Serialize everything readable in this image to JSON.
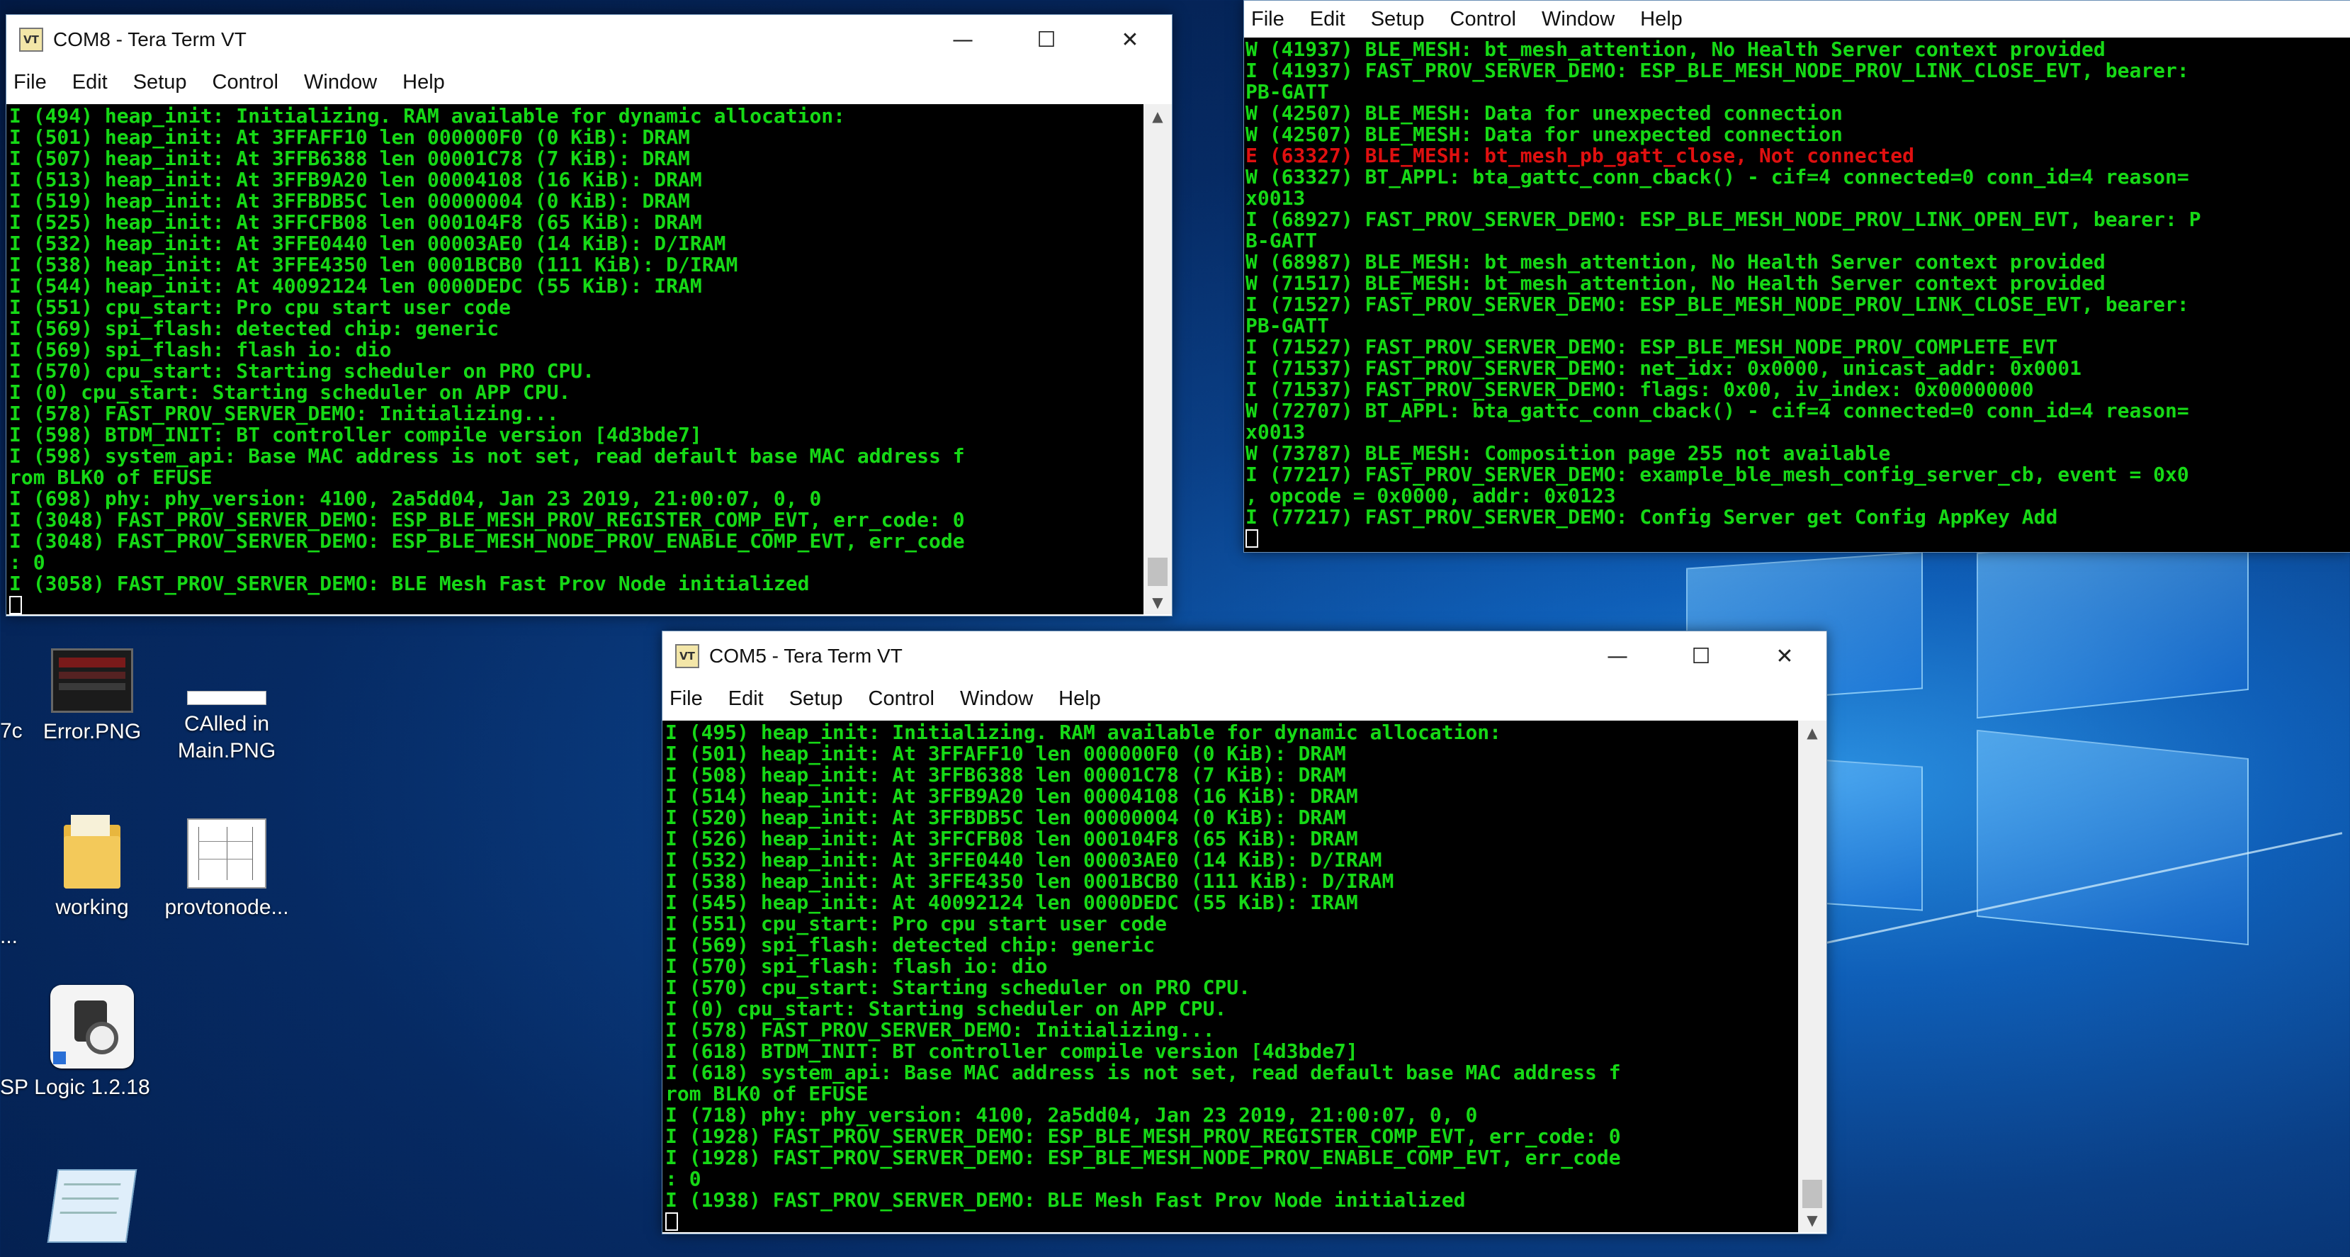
{
  "menu": [
    "File",
    "Edit",
    "Setup",
    "Control",
    "Window",
    "Help"
  ],
  "window_controls": {
    "minimize": "—",
    "maximize": "☐",
    "close": "✕"
  },
  "app_icon_text": "VT",
  "com8": {
    "title": "COM8 - Tera Term VT",
    "lines": [
      "I (494) heap_init: Initializing. RAM available for dynamic allocation:",
      "I (501) heap_init: At 3FFAFF10 len 000000F0 (0 KiB): DRAM",
      "I (507) heap_init: At 3FFB6388 len 00001C78 (7 KiB): DRAM",
      "I (513) heap_init: At 3FFB9A20 len 00004108 (16 KiB): DRAM",
      "I (519) heap_init: At 3FFBDB5C len 00000004 (0 KiB): DRAM",
      "I (525) heap_init: At 3FFCFB08 len 000104F8 (65 KiB): DRAM",
      "I (532) heap_init: At 3FFE0440 len 00003AE0 (14 KiB): D/IRAM",
      "I (538) heap_init: At 3FFE4350 len 0001BCB0 (111 KiB): D/IRAM",
      "I (544) heap_init: At 40092124 len 0000DEDC (55 KiB): IRAM",
      "I (551) cpu_start: Pro cpu start user code",
      "I (569) spi_flash: detected chip: generic",
      "I (569) spi_flash: flash io: dio",
      "I (570) cpu_start: Starting scheduler on PRO CPU.",
      "I (0) cpu_start: Starting scheduler on APP CPU.",
      "I (578) FAST_PROV_SERVER_DEMO: Initializing...",
      "I (598) BTDM_INIT: BT controller compile version [4d3bde7]",
      "I (598) system_api: Base MAC address is not set, read default base MAC address f",
      "rom BLK0 of EFUSE",
      "I (698) phy: phy_version: 4100, 2a5dd04, Jan 23 2019, 21:00:07, 0, 0",
      "I (3048) FAST_PROV_SERVER_DEMO: ESP_BLE_MESH_PROV_REGISTER_COMP_EVT, err_code: 0",
      "I (3048) FAST_PROV_SERVER_DEMO: ESP_BLE_MESH_NODE_PROV_ENABLE_COMP_EVT, err_code",
      ": 0",
      "I (3058) FAST_PROV_SERVER_DEMO: BLE Mesh Fast Prov Node initialized"
    ]
  },
  "right_term": {
    "lines": [
      {
        "t": "W (41937) BLE_MESH: bt_mesh_attention, No Health Server context provided",
        "c": "g"
      },
      {
        "t": "I (41937) FAST_PROV_SERVER_DEMO: ESP_BLE_MESH_NODE_PROV_LINK_CLOSE_EVT, bearer:",
        "c": "g"
      },
      {
        "t": "PB-GATT",
        "c": "g"
      },
      {
        "t": "W (42507) BLE_MESH: Data for unexpected connection",
        "c": "g"
      },
      {
        "t": "W (42507) BLE_MESH: Data for unexpected connection",
        "c": "g"
      },
      {
        "t": "E (63327) BLE_MESH: bt_mesh_pb_gatt_close, Not connected",
        "c": "r"
      },
      {
        "t": "W (63327) BT_APPL: bta_gattc_conn_cback() - cif=4 connected=0 conn_id=4 reason=",
        "c": "g"
      },
      {
        "t": "x0013",
        "c": "g"
      },
      {
        "t": "I (68927) FAST_PROV_SERVER_DEMO: ESP_BLE_MESH_NODE_PROV_LINK_OPEN_EVT, bearer: P",
        "c": "g"
      },
      {
        "t": "B-GATT",
        "c": "g"
      },
      {
        "t": "W (68987) BLE_MESH: bt_mesh_attention, No Health Server context provided",
        "c": "g"
      },
      {
        "t": "W (71517) BLE_MESH: bt_mesh_attention, No Health Server context provided",
        "c": "g"
      },
      {
        "t": "I (71527) FAST_PROV_SERVER_DEMO: ESP_BLE_MESH_NODE_PROV_LINK_CLOSE_EVT, bearer:",
        "c": "g"
      },
      {
        "t": "PB-GATT",
        "c": "g"
      },
      {
        "t": "I (71527) FAST_PROV_SERVER_DEMO: ESP_BLE_MESH_NODE_PROV_COMPLETE_EVT",
        "c": "g"
      },
      {
        "t": "I (71537) FAST_PROV_SERVER_DEMO: net_idx: 0x0000, unicast_addr: 0x0001",
        "c": "g"
      },
      {
        "t": "I (71537) FAST_PROV_SERVER_DEMO: flags: 0x00, iv_index: 0x00000000",
        "c": "g"
      },
      {
        "t": "W (72707) BT_APPL: bta_gattc_conn_cback() - cif=4 connected=0 conn_id=4 reason=",
        "c": "g"
      },
      {
        "t": "x0013",
        "c": "g"
      },
      {
        "t": "W (73787) BLE_MESH: Composition page 255 not available",
        "c": "g"
      },
      {
        "t": "I (77217) FAST_PROV_SERVER_DEMO: example_ble_mesh_config_server_cb, event = 0x0",
        "c": "g"
      },
      {
        "t": ", opcode = 0x0000, addr: 0x0123",
        "c": "g"
      },
      {
        "t": "I (77217) FAST_PROV_SERVER_DEMO: Config Server get Config AppKey Add",
        "c": "g"
      }
    ]
  },
  "com5": {
    "title": "COM5 - Tera Term VT",
    "lines": [
      "I (495) heap_init: Initializing. RAM available for dynamic allocation:",
      "I (501) heap_init: At 3FFAFF10 len 000000F0 (0 KiB): DRAM",
      "I (508) heap_init: At 3FFB6388 len 00001C78 (7 KiB): DRAM",
      "I (514) heap_init: At 3FFB9A20 len 00004108 (16 KiB): DRAM",
      "I (520) heap_init: At 3FFBDB5C len 00000004 (0 KiB): DRAM",
      "I (526) heap_init: At 3FFCFB08 len 000104F8 (65 KiB): DRAM",
      "I (532) heap_init: At 3FFE0440 len 00003AE0 (14 KiB): D/IRAM",
      "I (538) heap_init: At 3FFE4350 len 0001BCB0 (111 KiB): D/IRAM",
      "I (545) heap_init: At 40092124 len 0000DEDC (55 KiB): IRAM",
      "I (551) cpu_start: Pro cpu start user code",
      "I (569) spi_flash: detected chip: generic",
      "I (570) spi_flash: flash io: dio",
      "I (570) cpu_start: Starting scheduler on PRO CPU.",
      "I (0) cpu_start: Starting scheduler on APP CPU.",
      "I (578) FAST_PROV_SERVER_DEMO: Initializing...",
      "I (618) BTDM_INIT: BT controller compile version [4d3bde7]",
      "I (618) system_api: Base MAC address is not set, read default base MAC address f",
      "rom BLK0 of EFUSE",
      "I (718) phy: phy_version: 4100, 2a5dd04, Jan 23 2019, 21:00:07, 0, 0",
      "I (1928) FAST_PROV_SERVER_DEMO: ESP_BLE_MESH_PROV_REGISTER_COMP_EVT, err_code: 0",
      "I (1928) FAST_PROV_SERVER_DEMO: ESP_BLE_MESH_NODE_PROV_ENABLE_COMP_EVT, err_code",
      ": 0",
      "I (1938) FAST_PROV_SERVER_DEMO: BLE Mesh Fast Prov Node initialized"
    ]
  },
  "desktop_icons": [
    {
      "name": "error-png-file-icon",
      "label": "Error.PNG",
      "label2": ""
    },
    {
      "name": "called-in-main-png-file-icon",
      "label": "CAlled in",
      "label2": "Main.PNG"
    },
    {
      "name": "working-folder-icon",
      "label": "working",
      "label2": ""
    },
    {
      "name": "provtonode-file-icon",
      "label": "provtonode...",
      "label2": ""
    },
    {
      "name": "logic-app-icon",
      "label": "Logic 1.2.18",
      "label2": ""
    },
    {
      "name": "notepad-icon",
      "label": "",
      "label2": ""
    }
  ],
  "edge_labels": {
    "left_7c": "7c",
    "left_dots": "...",
    "left_sp": "SP"
  }
}
